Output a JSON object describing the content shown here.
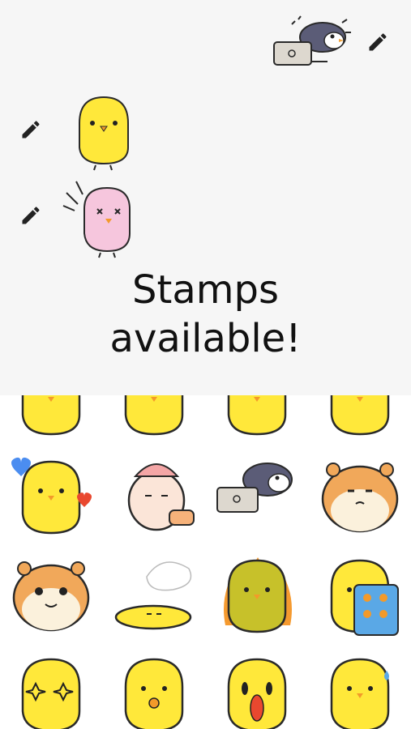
{
  "headline": {
    "line1": "Stamps",
    "line2": "available!"
  },
  "chat": {
    "messages": [
      {
        "sticker": "penguin-laptop",
        "side": "right"
      },
      {
        "sticker": "yellow-chick",
        "side": "left"
      },
      {
        "sticker": "pink-chick-dizzy",
        "side": "left"
      }
    ],
    "edit_icon": "pencil-icon"
  },
  "stickers": [
    "chick-stars",
    "chick-partial",
    "chick-partial-2",
    "chick-partial-3",
    "chick-hearts",
    "bunny-sleepy",
    "penguin-laptop",
    "hamster-grumpy",
    "hamster-teary",
    "chick-melted",
    "chick-fire",
    "chick-box-phone",
    "chick-sparkle-eyes",
    "chick-whistle",
    "chick-shocked",
    "chick-sweat"
  ],
  "colors": {
    "chick": "#ffe83a",
    "pink": "#f6c6dd",
    "outline": "#2a2a2a",
    "background": "#f6f6f6"
  }
}
